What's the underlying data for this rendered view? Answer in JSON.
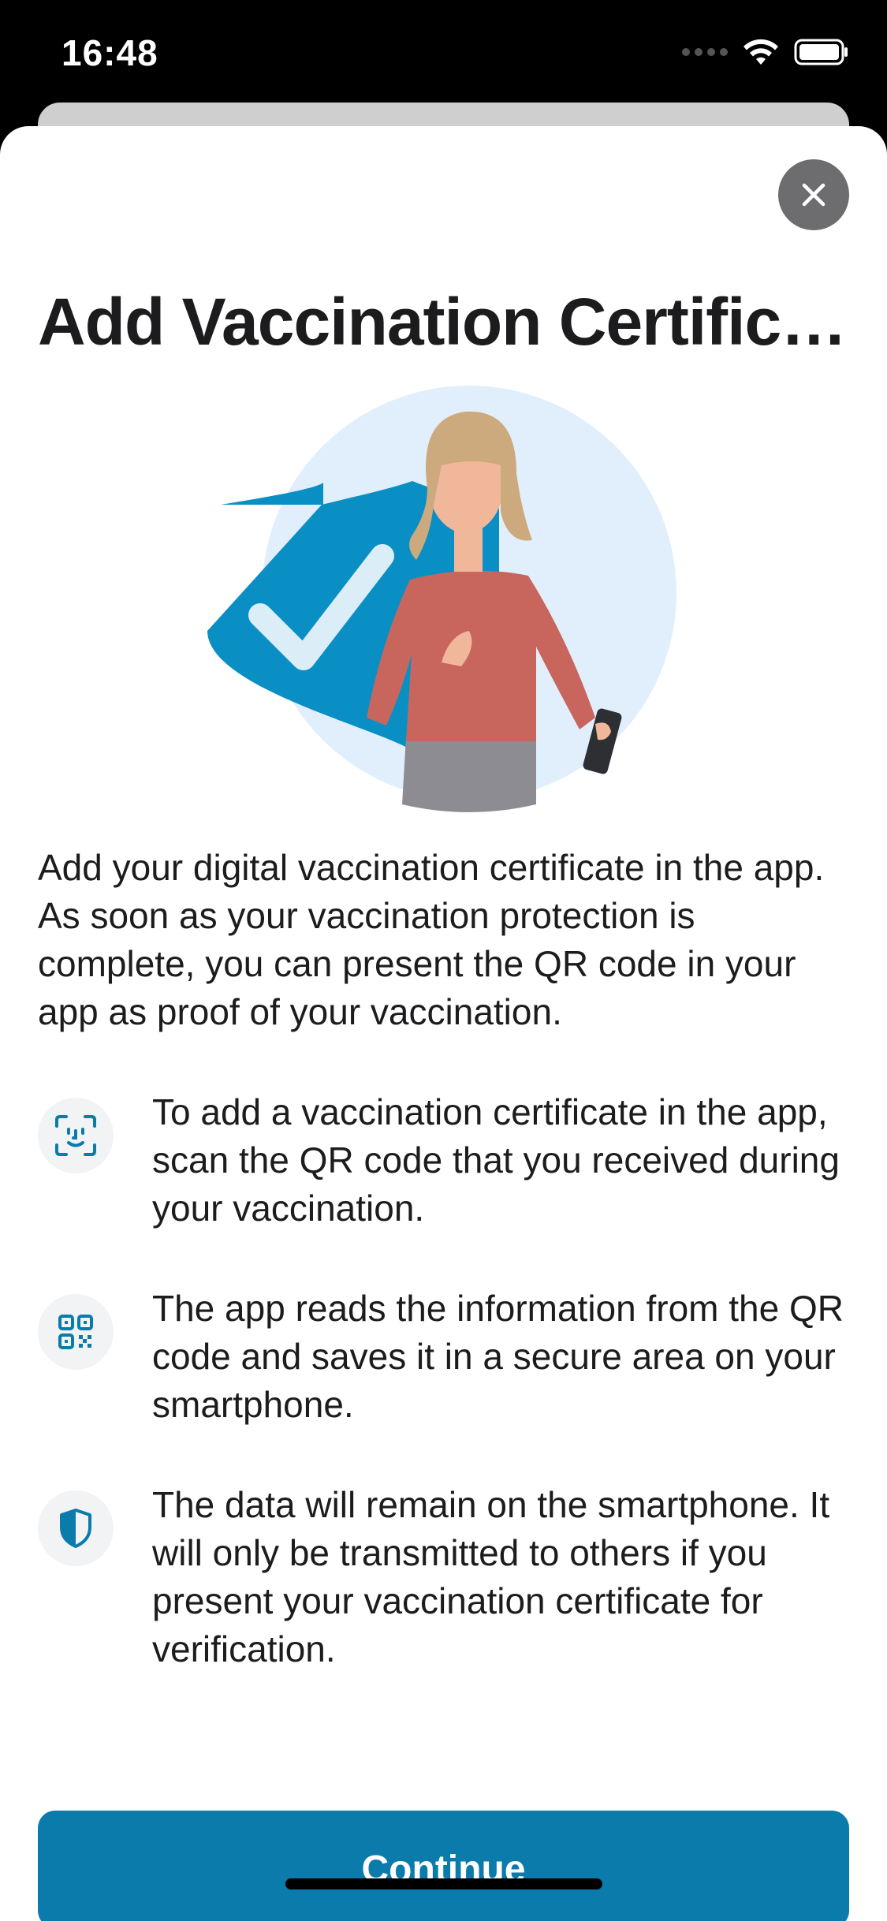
{
  "status_bar": {
    "time": "16:48",
    "icons": [
      "signal-icon",
      "wifi-icon",
      "battery-icon"
    ]
  },
  "modal": {
    "close_icon": "close-icon",
    "title": "Add Vaccination Certifica...",
    "intro": "Add your digital vaccination certificate in the app. As soon as your vaccination protection is complete, you can present the QR code in your app as proof of your vaccination.",
    "features": [
      {
        "icon": "face-scan-icon",
        "text": "To add a vaccination certificate in the app, scan the QR code that you received during your vaccination."
      },
      {
        "icon": "qr-code-icon",
        "text": "The app reads the information from the QR code and saves it in a secure area on your smartphone."
      },
      {
        "icon": "shield-icon",
        "text": "The data will remain on the smartphone. It will only be transmitted to others if you present your vaccination certificate for verification."
      }
    ],
    "continue_label": "Continue"
  },
  "colors": {
    "accent": "#0b7bab",
    "shield": "#0a8fc4",
    "illustration_bg": "#e1effc",
    "text": "#1c1c1e",
    "close_bg": "#6d6d6f"
  }
}
